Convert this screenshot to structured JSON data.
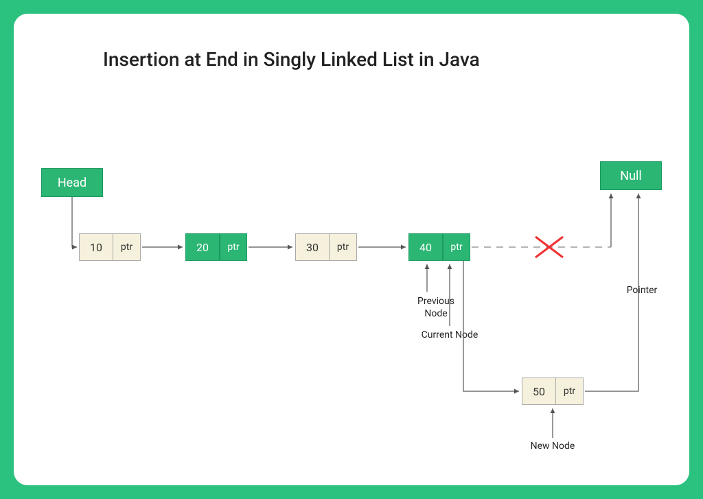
{
  "title": "Insertion at End in Singly Linked List in Java",
  "head_label": "Head",
  "null_label": "Null",
  "nodes": {
    "n1": {
      "data": "10",
      "ptr": "ptr"
    },
    "n2": {
      "data": "20",
      "ptr": "ptr"
    },
    "n3": {
      "data": "30",
      "ptr": "ptr"
    },
    "n4": {
      "data": "40",
      "ptr": "ptr"
    },
    "n5": {
      "data": "50",
      "ptr": "ptr"
    }
  },
  "labels": {
    "previous": "Previous Node",
    "current": "Current Node",
    "newnode": "New Node",
    "pointer": "Pointer"
  }
}
